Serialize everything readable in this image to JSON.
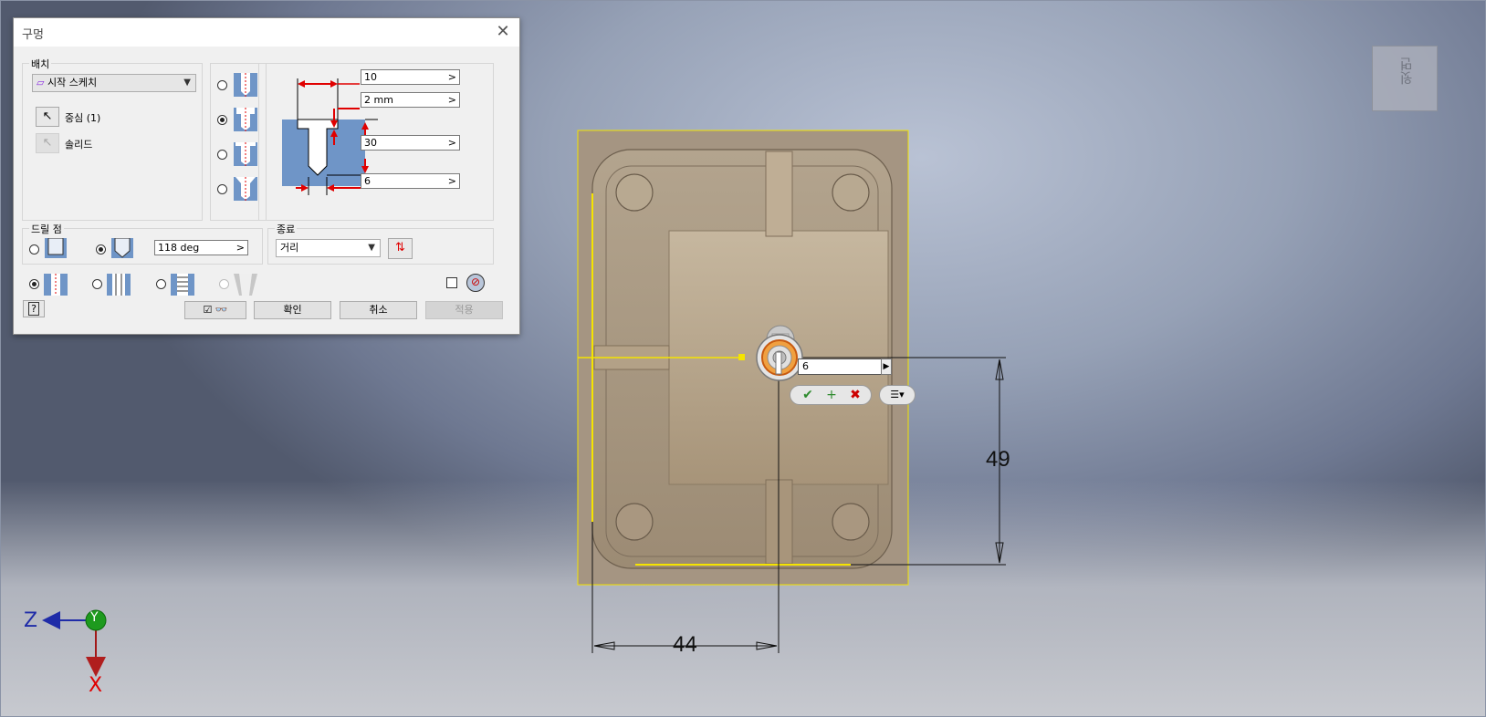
{
  "dialog": {
    "title": "구멍",
    "close_glyph": "✕",
    "placement": {
      "group_label": "배치",
      "sketch_value": "시작 스케치",
      "center_label": "중심 (1)",
      "solid_label": "솔리드"
    },
    "dims": {
      "cbore_diameter": "10",
      "cbore_depth": "2 mm",
      "hole_depth": "30",
      "hole_diameter": "6"
    },
    "drill_point": {
      "group_label": "드릴 점",
      "angle": "118 deg"
    },
    "termination": {
      "group_label": "종료",
      "value": "거리"
    },
    "buttons": {
      "ok": "확인",
      "cancel": "취소",
      "apply": "적용"
    },
    "help_glyph": "?"
  },
  "viewport": {
    "view_cube_label": "윗면",
    "axes": {
      "z": "Z",
      "y": "Y",
      "x": "X"
    },
    "dimension_width": "44",
    "dimension_height": "49",
    "inline_value": "6"
  },
  "colors": {
    "accent_red": "#e00000",
    "sketch_yellow": "#f5e400",
    "part_tan": "#a89680",
    "ok_green": "#2e8b2e",
    "cancel_red": "#cc0000"
  }
}
